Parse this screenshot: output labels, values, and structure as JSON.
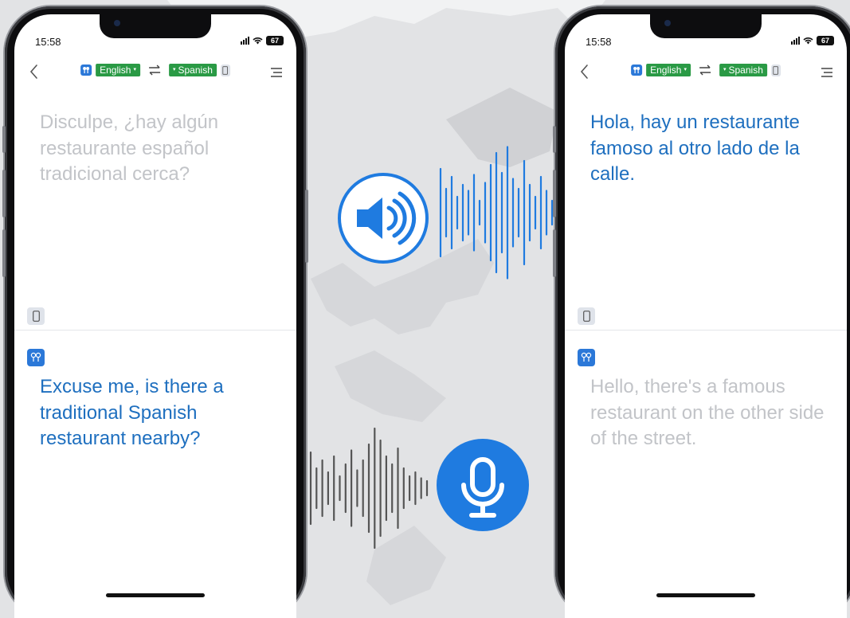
{
  "colors": {
    "accent_blue": "#1e6fbf",
    "icon_blue": "#1f7be0",
    "chip_green": "#2a9a45",
    "muted_text": "#c2c4c8",
    "waveform_gray": "#555555"
  },
  "left_phone": {
    "status": {
      "time": "15:58",
      "battery": "67"
    },
    "nav": {
      "source_lang": "English",
      "target_lang": "Spanish"
    },
    "upper_text": "Disculpe, ¿hay algún restaurante español tradicional cerca?",
    "lower_text": "Excuse me, is there a traditional Spanish restaurant nearby?",
    "upper_state": "muted",
    "lower_state": "active"
  },
  "right_phone": {
    "status": {
      "time": "15:58",
      "battery": "67"
    },
    "nav": {
      "source_lang": "English",
      "target_lang": "Spanish"
    },
    "upper_text": "Hola, hay un restaurante famoso al otro lado de la calle.",
    "lower_text": "Hello, there's a famous restaurant on the other side of the street.",
    "upper_state": "active",
    "lower_state": "muted"
  },
  "center_icons": {
    "top": "speaker-sound-icon",
    "bottom": "microphone-icon"
  }
}
